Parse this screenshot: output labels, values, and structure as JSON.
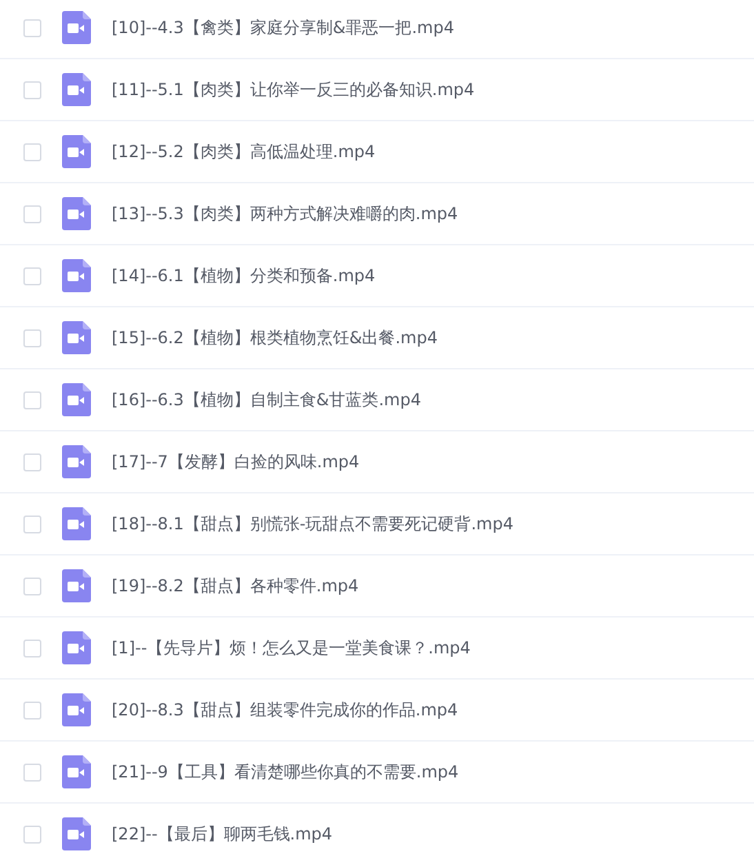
{
  "files": [
    {
      "name": "[10]--4.3【禽类】家庭分享制&罪恶一把.mp4",
      "checked": false
    },
    {
      "name": "[11]--5.1【肉类】让你举一反三的必备知识.mp4",
      "checked": false
    },
    {
      "name": "[12]--5.2【肉类】高低温处理.mp4",
      "checked": false
    },
    {
      "name": "[13]--5.3【肉类】两种方式解决难嚼的肉.mp4",
      "checked": false
    },
    {
      "name": "[14]--6.1【植物】分类和预备.mp4",
      "checked": false
    },
    {
      "name": "[15]--6.2【植物】根类植物烹饪&出餐.mp4",
      "checked": false
    },
    {
      "name": "[16]--6.3【植物】自制主食&甘蓝类.mp4",
      "checked": false
    },
    {
      "name": "[17]--7【发酵】白捡的风味.mp4",
      "checked": false
    },
    {
      "name": "[18]--8.1【甜点】别慌张-玩甜点不需要死记硬背.mp4",
      "checked": false
    },
    {
      "name": "[19]--8.2【甜点】各种零件.mp4",
      "checked": false
    },
    {
      "name": "[1]--【先导片】烦！怎么又是一堂美食课？.mp4",
      "checked": false
    },
    {
      "name": "[20]--8.3【甜点】组装零件完成你的作品.mp4",
      "checked": false
    },
    {
      "name": "[21]--9【工具】看清楚哪些你真的不需要.mp4",
      "checked": false
    },
    {
      "name": "[22]--【最后】聊两毛钱.mp4",
      "checked": false
    }
  ]
}
